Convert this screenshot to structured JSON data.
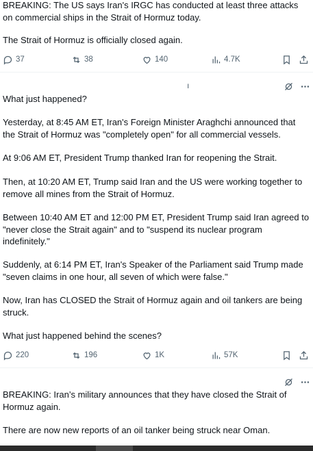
{
  "colors": {
    "text": "#0f1419",
    "muted": "#536471",
    "divider": "#eff3f4",
    "bottom_bar": "#2b2b2b"
  },
  "post1": {
    "paragraphs": [
      "BREAKING: The US says Iran's IRGC has conducted at least three attacks on commercial ships in the Strait of Hormuz today.",
      "The Strait of Hormuz is officially closed again."
    ],
    "actions": {
      "replies": "37",
      "reposts": "38",
      "likes": "140",
      "views": "4.7K"
    },
    "icons": [
      "reply-icon",
      "repost-icon",
      "like-icon",
      "views-icon",
      "bookmark-icon",
      "share-icon"
    ]
  },
  "post2": {
    "stray_mark": "ı",
    "paragraphs": [
      "What just happened?",
      "Yesterday, at 8:45 AM ET, Iran's Foreign Minister Araghchi announced that the Strait of Hormuz was \"completely open\" for all commercial vessels.",
      "At 9:06 AM ET, President Trump thanked Iran for reopening the Strait.",
      "Then, at 10:20 AM ET, Trump said Iran and the US were working together to remove all mines from the Strait of Hormuz.",
      "Between 10:40 AM ET and 12:00 PM ET, President Trump said Iran agreed to \"never close the Strait again\" and to \"suspend its nuclear program indefinitely.\"",
      "Suddenly, at 6:14 PM ET, Iran's Speaker of the Parliament said Trump made \"seven claims in one hour, all seven of which were false.\"",
      "Now, Iran has CLOSED the Strait of Hormuz again and oil tankers are being struck.",
      "What just happened behind the scenes?"
    ],
    "actions": {
      "replies": "220",
      "reposts": "196",
      "likes": "1K",
      "views": "57K"
    },
    "icons": [
      "grok-icon",
      "more-icon"
    ]
  },
  "post3": {
    "paragraphs": [
      "BREAKING: Iran’s military announces that they have closed the Strait of Hormuz again.",
      "There are now new reports of an oil tanker being struck near Oman."
    ],
    "icons": [
      "grok-icon",
      "more-icon"
    ]
  }
}
